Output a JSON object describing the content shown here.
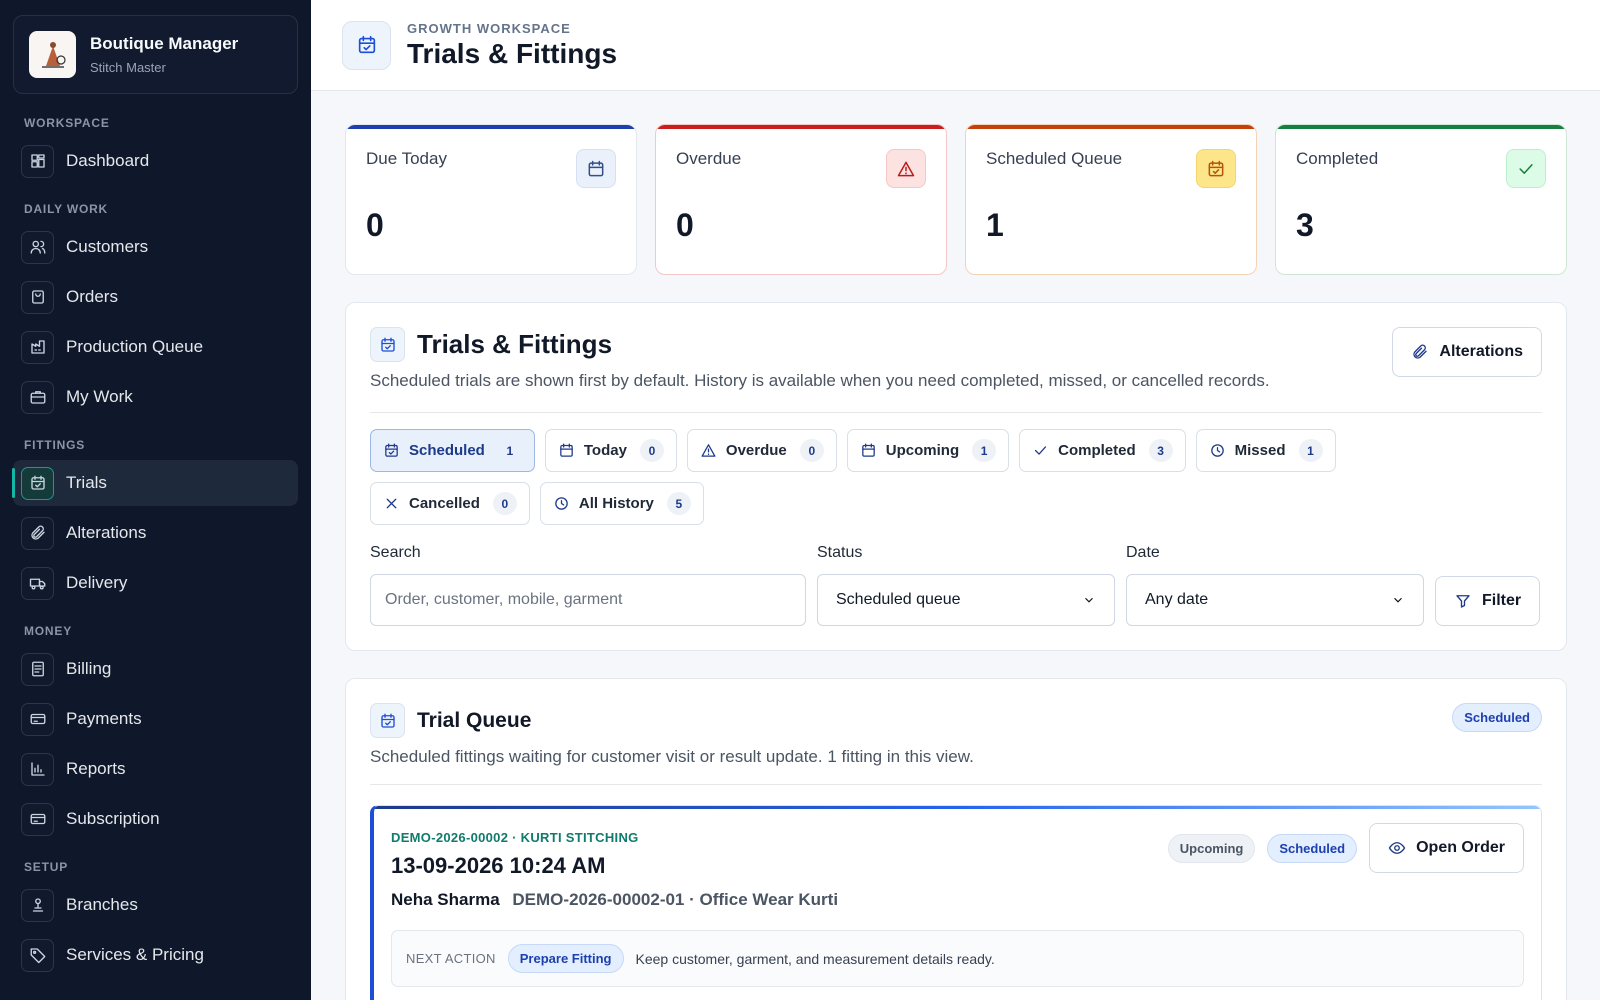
{
  "brand": {
    "title": "Boutique Manager",
    "subtitle": "Stitch Master"
  },
  "sidebar": {
    "sections": [
      {
        "label": "WORKSPACE",
        "items": [
          {
            "label": "Dashboard",
            "icon": "grid-icon"
          }
        ]
      },
      {
        "label": "DAILY WORK",
        "items": [
          {
            "label": "Customers",
            "icon": "users-icon"
          },
          {
            "label": "Orders",
            "icon": "bag-icon"
          },
          {
            "label": "Production Queue",
            "icon": "factory-icon"
          },
          {
            "label": "My Work",
            "icon": "briefcase-icon"
          }
        ]
      },
      {
        "label": "FITTINGS",
        "items": [
          {
            "label": "Trials",
            "icon": "calendar-check-icon",
            "active": true
          },
          {
            "label": "Alterations",
            "icon": "paperclip-icon"
          },
          {
            "label": "Delivery",
            "icon": "truck-icon"
          }
        ]
      },
      {
        "label": "MONEY",
        "items": [
          {
            "label": "Billing",
            "icon": "receipt-icon"
          },
          {
            "label": "Payments",
            "icon": "card-icon"
          },
          {
            "label": "Reports",
            "icon": "bar-chart-icon"
          },
          {
            "label": "Subscription",
            "icon": "card-icon"
          }
        ]
      },
      {
        "label": "SETUP",
        "items": [
          {
            "label": "Branches",
            "icon": "branch-icon"
          },
          {
            "label": "Services & Pricing",
            "icon": "tag-icon"
          }
        ]
      }
    ]
  },
  "header": {
    "eyebrow": "GROWTH WORKSPACE",
    "title": "Trials & Fittings"
  },
  "stats": [
    {
      "label": "Due Today",
      "value": "0",
      "accent": "#1e40af"
    },
    {
      "label": "Overdue",
      "value": "0",
      "accent": "#c81e1e"
    },
    {
      "label": "Scheduled Queue",
      "value": "1",
      "accent": "#c2410c"
    },
    {
      "label": "Completed",
      "value": "3",
      "accent": "#15803d"
    }
  ],
  "filters_panel": {
    "title": "Trials & Fittings",
    "description": "Scheduled trials are shown first by default. History is available when you need completed, missed, or cancelled records.",
    "alterations_button": "Alterations",
    "tabs": [
      {
        "label": "Scheduled",
        "count": "1"
      },
      {
        "label": "Today",
        "count": "0"
      },
      {
        "label": "Overdue",
        "count": "0"
      },
      {
        "label": "Upcoming",
        "count": "1"
      },
      {
        "label": "Completed",
        "count": "3"
      },
      {
        "label": "Missed",
        "count": "1"
      },
      {
        "label": "Cancelled",
        "count": "0"
      },
      {
        "label": "All History",
        "count": "5"
      }
    ],
    "search_label": "Search",
    "search_placeholder": "Order, customer, mobile, garment",
    "status_label": "Status",
    "status_value": "Scheduled queue",
    "date_label": "Date",
    "date_value": "Any date",
    "filter_button": "Filter"
  },
  "queue": {
    "title": "Trial Queue",
    "badge": "Scheduled",
    "description": "Scheduled fittings waiting for customer visit or result update. 1 fitting in this view.",
    "items": [
      {
        "order_code": "DEMO-2026-00002 · KURTI STITCHING",
        "datetime": "13-09-2026 10:24 AM",
        "customer": "Neha Sharma",
        "garment": "DEMO-2026-00002-01 · Office Wear Kurti",
        "badges": [
          "Upcoming",
          "Scheduled"
        ],
        "open_button": "Open Order",
        "next_action_label": "NEXT ACTION",
        "next_action": "Prepare Fitting",
        "next_action_text": "Keep customer, garment, and measurement details ready."
      }
    ]
  }
}
